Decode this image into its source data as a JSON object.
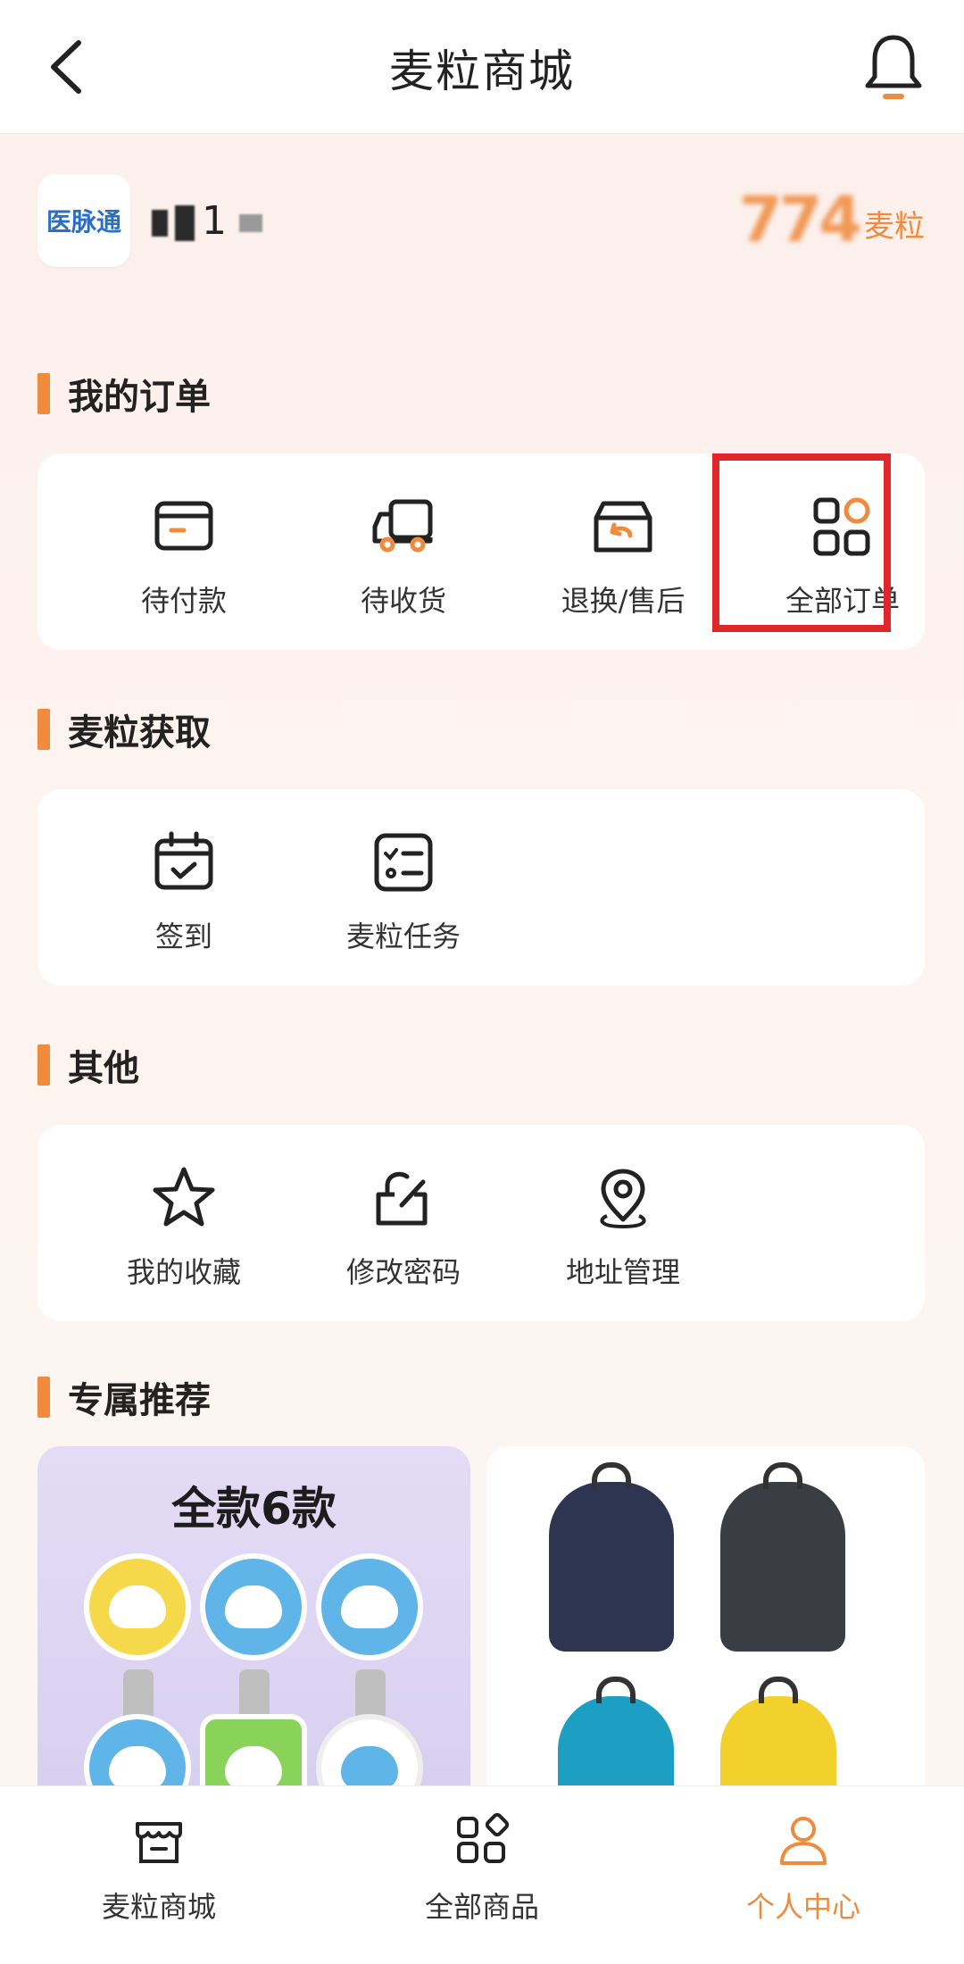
{
  "header": {
    "title": "麦粒商城"
  },
  "profile": {
    "logo_text": "医脉通",
    "username": "1",
    "points_value": "774",
    "points_unit": "麦粒"
  },
  "orders": {
    "title": "我的订单",
    "items": [
      {
        "label": "待付款",
        "icon": "wallet-icon"
      },
      {
        "label": "待收货",
        "icon": "truck-icon"
      },
      {
        "label": "退换/售后",
        "icon": "return-box-icon"
      },
      {
        "label": "全部订单",
        "icon": "grid-icon"
      }
    ]
  },
  "earn": {
    "title": "麦粒获取",
    "items": [
      {
        "label": "签到",
        "icon": "calendar-check-icon"
      },
      {
        "label": "麦粒任务",
        "icon": "task-list-icon"
      }
    ]
  },
  "other": {
    "title": "其他",
    "items": [
      {
        "label": "我的收藏",
        "icon": "star-icon"
      },
      {
        "label": "修改密码",
        "icon": "lock-edit-icon"
      },
      {
        "label": "地址管理",
        "icon": "location-pin-icon"
      }
    ]
  },
  "recommend": {
    "title": "专属推荐",
    "left_card_title": "全款6款"
  },
  "bottom_nav": {
    "items": [
      {
        "label": "麦粒商城",
        "icon": "shop-icon"
      },
      {
        "label": "全部商品",
        "icon": "products-grid-icon"
      },
      {
        "label": "个人中心",
        "icon": "user-icon"
      }
    ],
    "active_color": "#f08a3c"
  },
  "accent_color": "#f08a3c"
}
